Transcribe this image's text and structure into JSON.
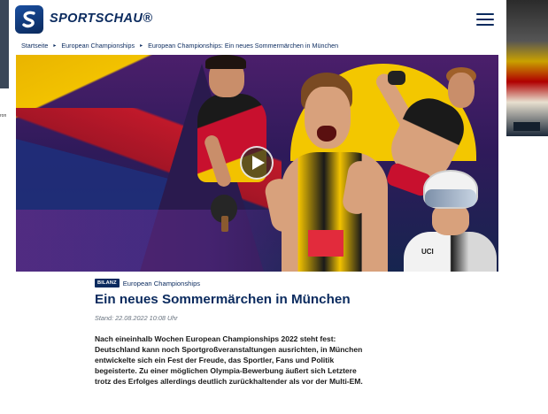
{
  "app": {
    "logo_text": "SPORTSCHAU®",
    "brand_color": "#0a2a5e"
  },
  "header": {
    "menu_icon": "hamburger-menu-icon"
  },
  "breadcrumb": {
    "items": [
      "Startseite",
      "European Championships",
      "European Championships: Ein neues Sommermärchen in München"
    ],
    "separator_icon": "triangle-right-icon"
  },
  "hero": {
    "play_icon": "play-icon",
    "cyclist_label": "UCI"
  },
  "article": {
    "badge": "BILANZ",
    "kicker": "European Championships",
    "headline": "Ein neues Sommermärchen in München",
    "date": "Stand: 22.08.2022 10:08 Uhr",
    "teaser_lines": [
      "Nach eineinhalb Wochen European Championships 2022 steht fest:",
      "Deutschland kann noch Sportgroßveranstaltungen ausrichten, in München",
      "entwickelte sich ein Fest der Freude, das Sportler, Fans und Politik",
      "begeisterte. Zu einer möglichen Olympia-Bewerbung äußert sich Letztere",
      "trotz des Erfolges allerdings deutlich zurückhaltender als vor der Multi-EM."
    ]
  },
  "background": {
    "left_fragment_text": "ron"
  }
}
